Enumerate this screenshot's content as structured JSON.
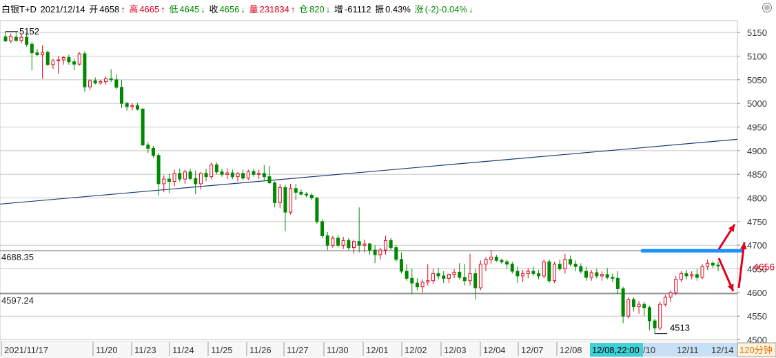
{
  "header": {
    "name": "白银T+D",
    "date": "2021/12/14",
    "open_label": "开",
    "open_value": "4658",
    "open_arrow": "↑",
    "high_label": "高",
    "high_value": "4665",
    "high_arrow": "↑",
    "low_label": "低",
    "low_value": "4645",
    "low_arrow": "↓",
    "close_label": "收",
    "close_value": "4656",
    "close_arrow": "↓",
    "volume_label": "量",
    "volume_value": "231834",
    "volume_arrow": "↑",
    "position_label": "仓",
    "position_value": "820",
    "position_arrow": "↓",
    "increase_label": "增",
    "increase_value": "-61112",
    "amplitude_label": "振",
    "amplitude_value": "0.43%",
    "change_label": "涨",
    "change_value": "(-2)-0.04%",
    "change_arrow": "↓"
  },
  "colors": {
    "up": "#e0001a",
    "down": "#008800",
    "grid": "#c8c8c8",
    "trend_line": "#1a3a7a",
    "highlight_line": "#1e90ff",
    "arrow": "#e0001a",
    "time_highlight_bg": "#3fd0d8",
    "time_range_bg": "#c8e0f5"
  },
  "chart_data": {
    "type": "candlestick",
    "ylim": [
      4495,
      5175
    ],
    "y_ticks": [
      "5150",
      "5100",
      "5050",
      "5000",
      "4950",
      "4900",
      "4850",
      "4800",
      "4750",
      "4700",
      "4650",
      "4600",
      "4550",
      "4500"
    ],
    "x_labels": [
      "2021/11/17",
      "11/20",
      "11/23",
      "11/24",
      "11/25",
      "11/26",
      "11/27",
      "11/30",
      "12/01",
      "12/02",
      "12/03",
      "12/04",
      "12/07",
      "12/08",
      "12/08,22:00",
      "/10",
      "12/11",
      "12/14"
    ],
    "cursor_time": "12/08,22:00",
    "period": "120分钟",
    "max_label": "5152",
    "min_label": "4513",
    "level_high_label": "4688.35",
    "level_high": 4688.35,
    "level_low_label": "4597.24",
    "level_low": 4597.24,
    "last_price_label": "4656",
    "last_price": 4656,
    "trend_line": {
      "start": 4787,
      "end": 4924
    },
    "candles": [
      [
        5141,
        5152,
        5130,
        5132
      ],
      [
        5132,
        5148,
        5128,
        5142
      ],
      [
        5140,
        5150,
        5131,
        5133
      ],
      [
        5133,
        5147,
        5127,
        5140
      ],
      [
        5140,
        5148,
        5120,
        5125
      ],
      [
        5125,
        5130,
        5070,
        5107
      ],
      [
        5107,
        5115,
        5100,
        5103
      ],
      [
        5103,
        5123,
        5052,
        5108
      ],
      [
        5108,
        5112,
        5080,
        5082
      ],
      [
        5082,
        5095,
        5073,
        5090
      ],
      [
        5090,
        5100,
        5063,
        5092
      ],
      [
        5092,
        5100,
        5082,
        5097
      ],
      [
        5097,
        5103,
        5082,
        5088
      ],
      [
        5088,
        5095,
        5070,
        5083
      ],
      [
        5083,
        5108,
        5080,
        5105
      ],
      [
        5105,
        5110,
        5025,
        5035
      ],
      [
        5035,
        5052,
        5028,
        5048
      ],
      [
        5048,
        5055,
        5040,
        5043
      ],
      [
        5043,
        5050,
        5040,
        5046
      ],
      [
        5046,
        5057,
        5040,
        5052
      ],
      [
        5052,
        5072,
        5045,
        5050
      ],
      [
        5050,
        5062,
        5030,
        5034
      ],
      [
        5034,
        5050,
        4990,
        5000
      ],
      [
        5000,
        5003,
        4985,
        4993
      ],
      [
        4993,
        5000,
        4985,
        4995
      ],
      [
        4995,
        5001,
        4985,
        4988
      ],
      [
        4988,
        4990,
        4910,
        4912
      ],
      [
        4912,
        4918,
        4895,
        4905
      ],
      [
        4905,
        4910,
        4885,
        4890
      ],
      [
        4890,
        4895,
        4805,
        4830
      ],
      [
        4830,
        4848,
        4812,
        4840
      ],
      [
        4840,
        4852,
        4810,
        4835
      ],
      [
        4835,
        4860,
        4825,
        4852
      ],
      [
        4852,
        4862,
        4835,
        4840
      ],
      [
        4840,
        4860,
        4830,
        4855
      ],
      [
        4855,
        4862,
        4838,
        4841
      ],
      [
        4841,
        4858,
        4808,
        4830
      ],
      [
        4830,
        4855,
        4818,
        4852
      ],
      [
        4852,
        4862,
        4835,
        4845
      ],
      [
        4845,
        4875,
        4840,
        4870
      ],
      [
        4870,
        4875,
        4850,
        4855
      ],
      [
        4855,
        4862,
        4845,
        4850
      ],
      [
        4850,
        4863,
        4840,
        4853
      ],
      [
        4853,
        4860,
        4840,
        4845
      ],
      [
        4845,
        4855,
        4835,
        4852
      ],
      [
        4852,
        4860,
        4838,
        4842
      ],
      [
        4842,
        4860,
        4838,
        4856
      ],
      [
        4856,
        4862,
        4845,
        4850
      ],
      [
        4850,
        4860,
        4840,
        4852
      ],
      [
        4852,
        4870,
        4835,
        4845
      ],
      [
        4845,
        4868,
        4830,
        4832
      ],
      [
        4832,
        4835,
        4780,
        4790
      ],
      [
        4790,
        4830,
        4778,
        4822
      ],
      [
        4822,
        4828,
        4730,
        4770
      ],
      [
        4770,
        4830,
        4765,
        4820
      ],
      [
        4820,
        4830,
        4795,
        4812
      ],
      [
        4812,
        4818,
        4805,
        4808
      ],
      [
        4808,
        4812,
        4802,
        4806
      ],
      [
        4806,
        4810,
        4795,
        4800
      ],
      [
        4800,
        4802,
        4745,
        4750
      ],
      [
        4750,
        4755,
        4715,
        4720
      ],
      [
        4720,
        4728,
        4690,
        4700
      ],
      [
        4700,
        4720,
        4695,
        4715
      ],
      [
        4715,
        4722,
        4695,
        4700
      ],
      [
        4700,
        4718,
        4692,
        4710
      ],
      [
        4710,
        4715,
        4690,
        4695
      ],
      [
        4695,
        4712,
        4682,
        4708
      ],
      [
        4708,
        4780,
        4685,
        4700
      ],
      [
        4700,
        4712,
        4685,
        4703
      ],
      [
        4703,
        4705,
        4680,
        4690
      ],
      [
        4690,
        4700,
        4662,
        4680
      ],
      [
        4680,
        4695,
        4670,
        4690
      ],
      [
        4690,
        4720,
        4680,
        4710
      ],
      [
        4710,
        4715,
        4690,
        4695
      ],
      [
        4695,
        4700,
        4665,
        4670
      ],
      [
        4670,
        4685,
        4640,
        4645
      ],
      [
        4645,
        4660,
        4625,
        4630
      ],
      [
        4630,
        4650,
        4598,
        4620
      ],
      [
        4620,
        4630,
        4605,
        4612
      ],
      [
        4612,
        4628,
        4600,
        4622
      ],
      [
        4622,
        4660,
        4615,
        4625
      ],
      [
        4625,
        4650,
        4618,
        4640
      ],
      [
        4640,
        4652,
        4628,
        4635
      ],
      [
        4635,
        4645,
        4620,
        4630
      ],
      [
        4630,
        4640,
        4620,
        4638
      ],
      [
        4638,
        4650,
        4630,
        4643
      ],
      [
        4643,
        4662,
        4628,
        4632
      ],
      [
        4632,
        4660,
        4615,
        4625
      ],
      [
        4625,
        4682,
        4615,
        4640
      ],
      [
        4640,
        4650,
        4585,
        4610
      ],
      [
        4610,
        4668,
        4605,
        4660
      ],
      [
        4660,
        4675,
        4645,
        4670
      ],
      [
        4670,
        4690,
        4660,
        4675
      ],
      [
        4675,
        4680,
        4665,
        4668
      ],
      [
        4668,
        4672,
        4660,
        4665
      ],
      [
        4665,
        4670,
        4650,
        4660
      ],
      [
        4660,
        4665,
        4640,
        4645
      ],
      [
        4645,
        4655,
        4620,
        4635
      ],
      [
        4635,
        4648,
        4622,
        4640
      ],
      [
        4640,
        4652,
        4630,
        4645
      ],
      [
        4645,
        4655,
        4635,
        4640
      ],
      [
        4640,
        4648,
        4628,
        4635
      ],
      [
        4635,
        4670,
        4630,
        4665
      ],
      [
        4665,
        4670,
        4620,
        4625
      ],
      [
        4625,
        4665,
        4620,
        4660
      ],
      [
        4660,
        4670,
        4645,
        4650
      ],
      [
        4650,
        4682,
        4640,
        4670
      ],
      [
        4670,
        4678,
        4655,
        4660
      ],
      [
        4660,
        4668,
        4645,
        4655
      ],
      [
        4655,
        4662,
        4640,
        4645
      ],
      [
        4645,
        4655,
        4625,
        4632
      ],
      [
        4632,
        4648,
        4625,
        4642
      ],
      [
        4642,
        4650,
        4630,
        4635
      ],
      [
        4635,
        4645,
        4625,
        4638
      ],
      [
        4638,
        4652,
        4628,
        4632
      ],
      [
        4632,
        4640,
        4622,
        4630
      ],
      [
        4630,
        4645,
        4598,
        4608
      ],
      [
        4608,
        4612,
        4535,
        4550
      ],
      [
        4550,
        4590,
        4545,
        4585
      ],
      [
        4585,
        4590,
        4560,
        4570
      ],
      [
        4570,
        4582,
        4555,
        4575
      ],
      [
        4575,
        4580,
        4550,
        4568
      ],
      [
        4568,
        4572,
        4520,
        4540
      ],
      [
        4540,
        4545,
        4513,
        4525
      ],
      [
        4525,
        4580,
        4520,
        4575
      ],
      [
        4575,
        4595,
        4570,
        4590
      ],
      [
        4590,
        4605,
        4580,
        4600
      ],
      [
        4600,
        4635,
        4595,
        4628
      ],
      [
        4628,
        4645,
        4622,
        4640
      ],
      [
        4640,
        4648,
        4628,
        4635
      ],
      [
        4635,
        4645,
        4628,
        4638
      ],
      [
        4638,
        4650,
        4625,
        4632
      ],
      [
        4632,
        4660,
        4628,
        4655
      ],
      [
        4655,
        4670,
        4648,
        4662
      ],
      [
        4662,
        4666,
        4652,
        4658
      ],
      [
        4658,
        4665,
        4645,
        4656
      ]
    ]
  }
}
